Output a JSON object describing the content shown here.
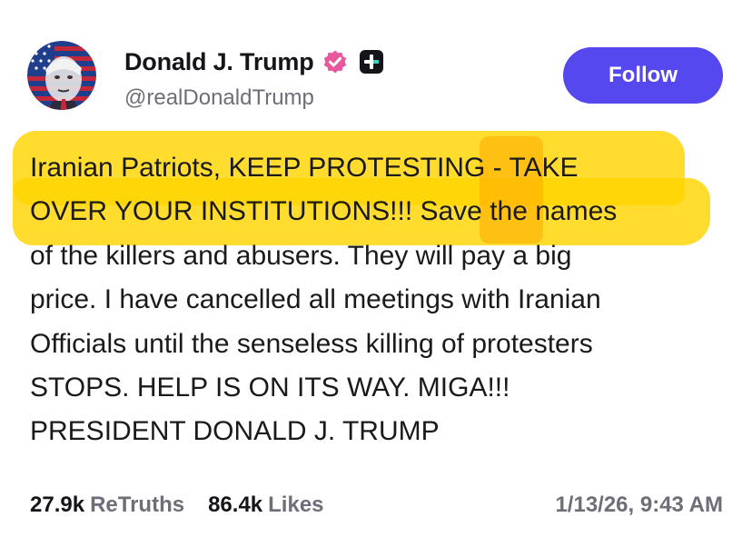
{
  "profile": {
    "display_name": "Donald J. Trump",
    "handle": "@realDonaldTrump",
    "verified_icon": "verified-badge-icon",
    "plus_icon": "plus-badge-icon",
    "avatar": "profile-avatar"
  },
  "actions": {
    "follow_label": "Follow"
  },
  "post": {
    "lines": [
      "Iranian Patriots, KEEP PROTESTING - TAKE",
      "OVER YOUR INSTITUTIONS!!! Save the names",
      "of the killers and abusers. They will pay a big",
      "price. I have cancelled all meetings with Iranian",
      "Officials until the senseless killing of protesters",
      "STOPS. HELP IS ON ITS WAY. MIGA!!!",
      "PRESIDENT DONALD J. TRUMP"
    ]
  },
  "stats": {
    "retruths_count": "27.9k",
    "retruths_label": "ReTruths",
    "likes_count": "86.4k",
    "likes_label": "Likes"
  },
  "timestamp": "1/13/26, 9:43 AM",
  "colors": {
    "accent": "#5448ee",
    "verified": "#e8589c",
    "highlight": "#ffd400",
    "secondary_text": "#6e6e78"
  }
}
